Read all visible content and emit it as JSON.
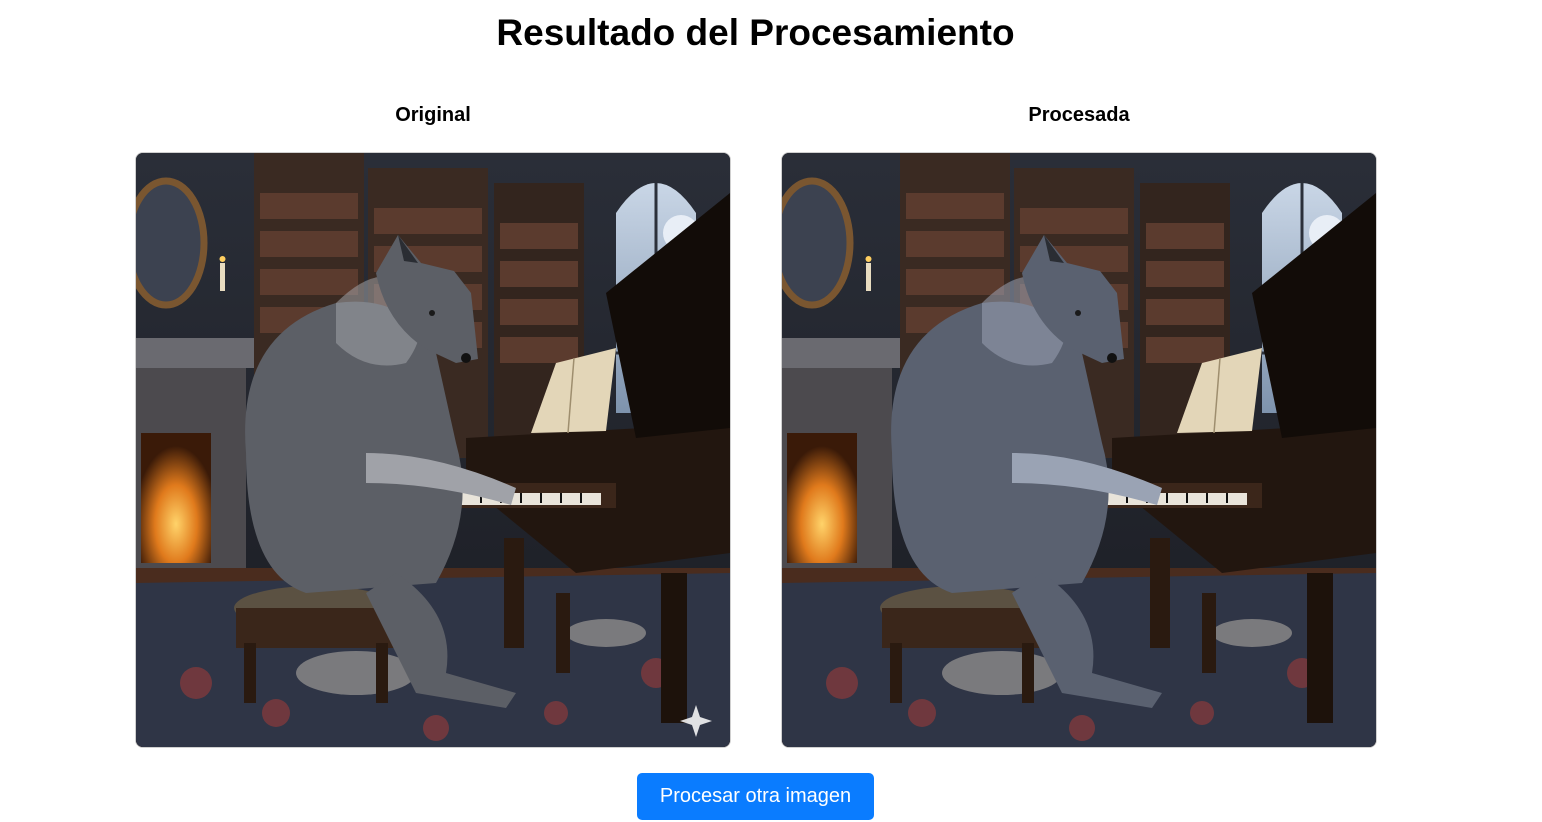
{
  "page": {
    "title": "Resultado del Procesamiento"
  },
  "panels": [
    {
      "label": "Original",
      "variant": "original"
    },
    {
      "label": "Procesada",
      "variant": "processed"
    }
  ],
  "actions": {
    "process_another_label": "Procesar otra imagen"
  },
  "colors": {
    "accent": "#0a7cff",
    "frame_border": "#d0d0d0"
  }
}
